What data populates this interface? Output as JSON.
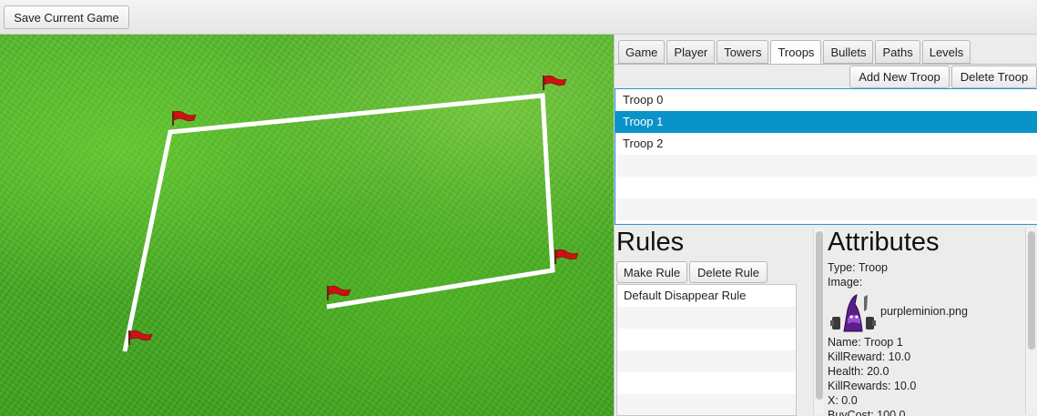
{
  "toolbar": {
    "save_label": "Save Current Game"
  },
  "tabs": [
    {
      "label": "Game"
    },
    {
      "label": "Player"
    },
    {
      "label": "Towers"
    },
    {
      "label": "Troops",
      "active": true
    },
    {
      "label": "Bullets"
    },
    {
      "label": "Paths"
    },
    {
      "label": "Levels"
    }
  ],
  "troops": {
    "add_label": "Add New Troop",
    "delete_label": "Delete Troop",
    "items": [
      "Troop 0",
      "Troop 1",
      "Troop 2"
    ],
    "selected": "Troop 1"
  },
  "rules": {
    "title": "Rules",
    "make_label": "Make Rule",
    "delete_label": "Delete Rule",
    "items": [
      "Default Disappear Rule"
    ]
  },
  "attributes": {
    "title": "Attributes",
    "type": "Type: Troop",
    "image_label": "Image:",
    "image_file": "purpleminion.png",
    "name": "Name: Troop 1",
    "kill_reward": "KillReward: 10.0",
    "health": "Health: 20.0",
    "kill_rewards": "KillRewards: 10.0",
    "x": "X: 0.0",
    "buy_cost": "BuyCost: 100.0"
  },
  "colors": {
    "accent": "#0a93c8",
    "grass": "#4cae27",
    "flag": "#cc1111",
    "path": "#ffffff"
  },
  "icons": {
    "flag": "flag-icon",
    "minion": "purple-minion-icon"
  }
}
